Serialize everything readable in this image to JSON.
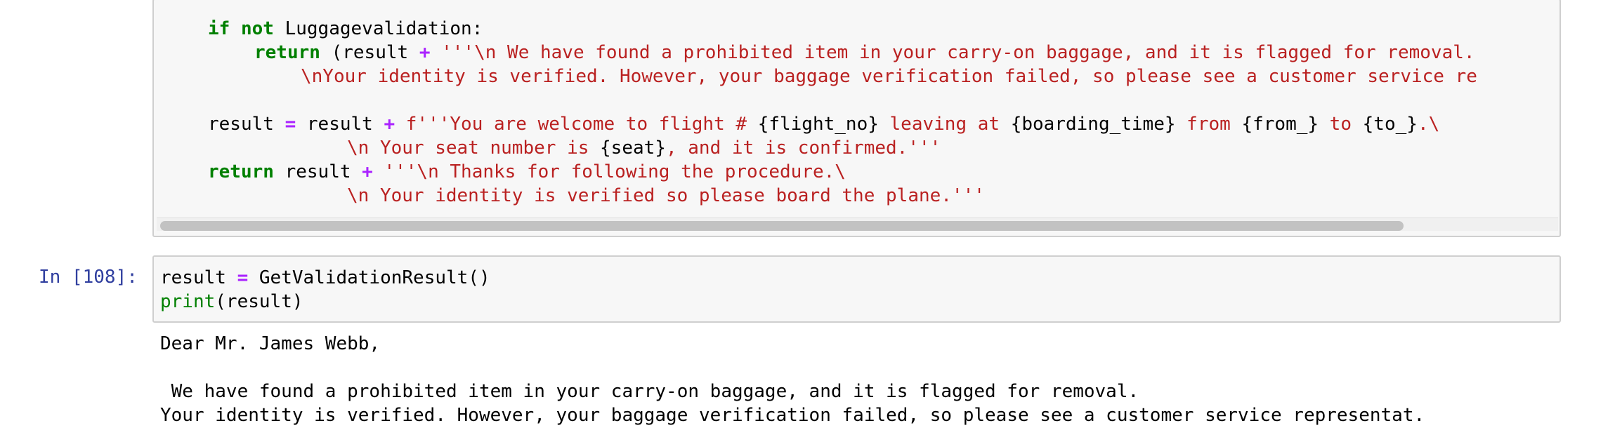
{
  "code_cell": {
    "lines": [
      {
        "a": "if",
        "b": " ",
        "c": "not",
        "d": " Luggagevalidation:"
      },
      {
        "a": "return",
        "b": " (result ",
        "c": "+",
        "d": " '''\\n We have found a prohibited item in your carry-on baggage, and it is flagged for removal."
      },
      {
        "text": "\\nYour identity is verified. However, your baggage verification failed, so please see a customer service re"
      },
      {
        "a": "result ",
        "b": "=",
        "c": " result ",
        "d": "+",
        "e": " f'''You are welcome to flight # ",
        "f": "{flight_no}",
        "g": " leaving at ",
        "h": "{boarding_time}",
        "i": " from ",
        "j": "{from_}",
        "k": " to ",
        "l": "{to_}",
        "m": ".\\"
      },
      {
        "a": "\\n Your seat number is ",
        "b": "{seat}",
        "c": ", and it is confirmed.'''"
      },
      {
        "a": "return",
        "b": " result ",
        "c": "+",
        "d": " '''\\n Thanks for following the procedure.\\"
      },
      {
        "text": "\\n Your identity is verified so please board the plane.'''"
      }
    ]
  },
  "input_cell": {
    "prompt": "In [108]:",
    "line1": {
      "a": "result ",
      "b": "=",
      "c": " GetValidationResult()"
    },
    "line2": {
      "a": "print",
      "b": "(result)"
    }
  },
  "output": {
    "lines": [
      "Dear Mr. James Webb,",
      "",
      " We have found a prohibited item in your carry-on baggage, and it is flagged for removal.",
      "Your identity is verified. However, your baggage verification failed, so please see a customer service representat."
    ]
  }
}
